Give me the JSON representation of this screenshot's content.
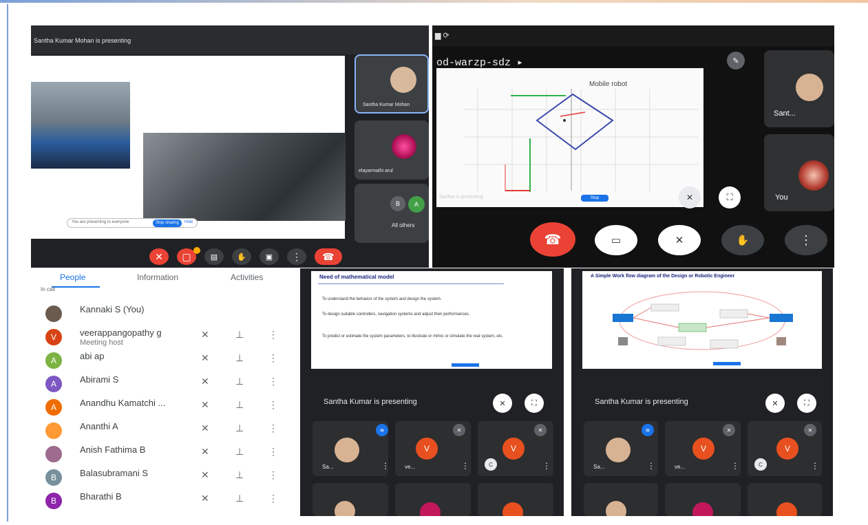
{
  "panel_a": {
    "banner": "Santha Kumar Mohan is presenting",
    "tiles": [
      {
        "label": "Santha Kumar Mohan"
      },
      {
        "label": "elayarmathi arul"
      },
      {
        "label": "All others"
      }
    ],
    "present_bar": {
      "text": "You are presenting to everyone",
      "stop": "Stop sharing",
      "dismiss": "Hide"
    }
  },
  "panel_b": {
    "meeting_code": "od-warzp-sdz ▸",
    "slide_title": "Mobile robot",
    "tiles": [
      {
        "label": "Sant..."
      },
      {
        "label": "You"
      }
    ],
    "status": "Santha is presenting",
    "pill": "Stop"
  },
  "people": {
    "tabs": [
      "People",
      "Information",
      "Activities"
    ],
    "section": "In call",
    "rows": [
      {
        "name": "Kannaki S (You)",
        "sub": "",
        "initial": "",
        "color": "#6b5b4f"
      },
      {
        "name": "veerappangopathy g",
        "sub": "Meeting host",
        "initial": "V",
        "color": "#d84315"
      },
      {
        "name": "abi ap",
        "sub": "",
        "initial": "A",
        "color": "#7cb342"
      },
      {
        "name": "Abirami S",
        "sub": "",
        "initial": "A",
        "color": "#7e57c2"
      },
      {
        "name": "Anandhu Kamatchi ...",
        "sub": "",
        "initial": "A",
        "color": "#ef6c00"
      },
      {
        "name": "Ananthi A",
        "sub": "",
        "initial": "",
        "color": "#ff9933"
      },
      {
        "name": "Anish Fathima B",
        "sub": "",
        "initial": "",
        "color": "#9c6b8e"
      },
      {
        "name": "Balasubramani S",
        "sub": "",
        "initial": "B",
        "color": "#78909c"
      },
      {
        "name": "Bharathi B",
        "sub": "",
        "initial": "B",
        "color": "#8e24aa"
      }
    ]
  },
  "panel_c": {
    "slide_title": "Need of mathematical model",
    "bullets": [
      "To understand the behavior of the system and design the system.",
      "To design suitable controllers, navigation systems and adjust their performances.",
      "To predict or estimate the system parameters, to illustrate or mimic or simulate the real system, etc."
    ],
    "status": "Santha Kumar is presenting",
    "tiles": [
      "Sa...",
      "ve...",
      ""
    ]
  },
  "panel_d": {
    "slide_title": "A Simple Work flow diagram of the Design or Robotic Engineer",
    "status": "Santha Kumar is presenting",
    "tiles": [
      "Sa...",
      "ve...",
      ""
    ]
  },
  "colors": {
    "end_call": "#ea4335",
    "meet_dark": "#202124",
    "tile": "#3c4043",
    "accent_blue": "#1a73e8"
  }
}
